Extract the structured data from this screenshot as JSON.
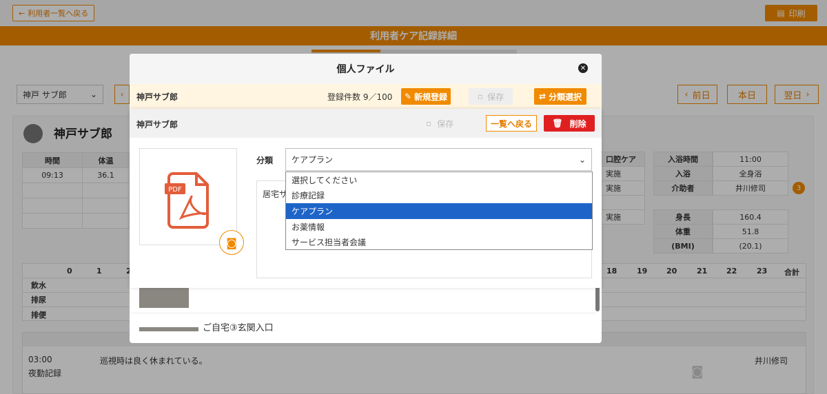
{
  "header": {
    "back_label": "利用者一覧へ戻る",
    "print_label": "印刷",
    "title": "利用者ケア記録詳細"
  },
  "nav": {
    "resident_select": "神戸 サブ郎",
    "prev_day": "前日",
    "today": "本日",
    "next_day": "翌日"
  },
  "resident": {
    "name": "神戸サブ郎"
  },
  "vitals": {
    "col_time": "時間",
    "col_temp": "体温",
    "time": "09:13",
    "temp": "36.1"
  },
  "care": {
    "header": "口腔ケア",
    "rows": [
      "実施",
      "実施",
      "実施"
    ]
  },
  "bath": {
    "rows": [
      {
        "k": "入浴時間",
        "v": "11:00"
      },
      {
        "k": "入浴",
        "v": "全身浴"
      },
      {
        "k": "介助者",
        "v": "井川修司"
      }
    ],
    "badge": "3"
  },
  "body": {
    "rows": [
      {
        "k": "身長",
        "v": "160.4"
      },
      {
        "k": "体重",
        "v": "51.8"
      },
      {
        "k": "(BMI)",
        "v": "(20.1)"
      }
    ]
  },
  "hours": {
    "left": [
      "0",
      "1",
      "2"
    ],
    "right": [
      "18",
      "19",
      "20",
      "21",
      "22",
      "23"
    ],
    "total": "合計",
    "rows": [
      "飲水",
      "排尿",
      "排便"
    ]
  },
  "log": {
    "time": "03:00",
    "type": "夜勤記録",
    "text": "巡視時は良く休まれている。",
    "staff": "井川修司"
  },
  "outer_modal": {
    "title": "個人ファイル",
    "name": "神戸サブ郎",
    "count": "登録件数 9／100",
    "new_label": "新規登録",
    "save_label": "保存",
    "category_label": "分類選択",
    "list_item": "ご自宅③玄関入口"
  },
  "inner_modal": {
    "name": "神戸サブ郎",
    "save_label": "保存",
    "back_label": "一覧へ戻る",
    "delete_label": "削除",
    "category_label": "分類",
    "selected": "ケアプラン",
    "textarea_prefix": "居宅サ",
    "options": [
      "選択してください",
      "診療記録",
      "ケアプラン",
      "お薬情報",
      "サービス担当者会議"
    ],
    "selected_index": 2
  },
  "colors": {
    "accent": "#f08a00",
    "danger": "#e02020",
    "selection": "#1e64c8"
  }
}
